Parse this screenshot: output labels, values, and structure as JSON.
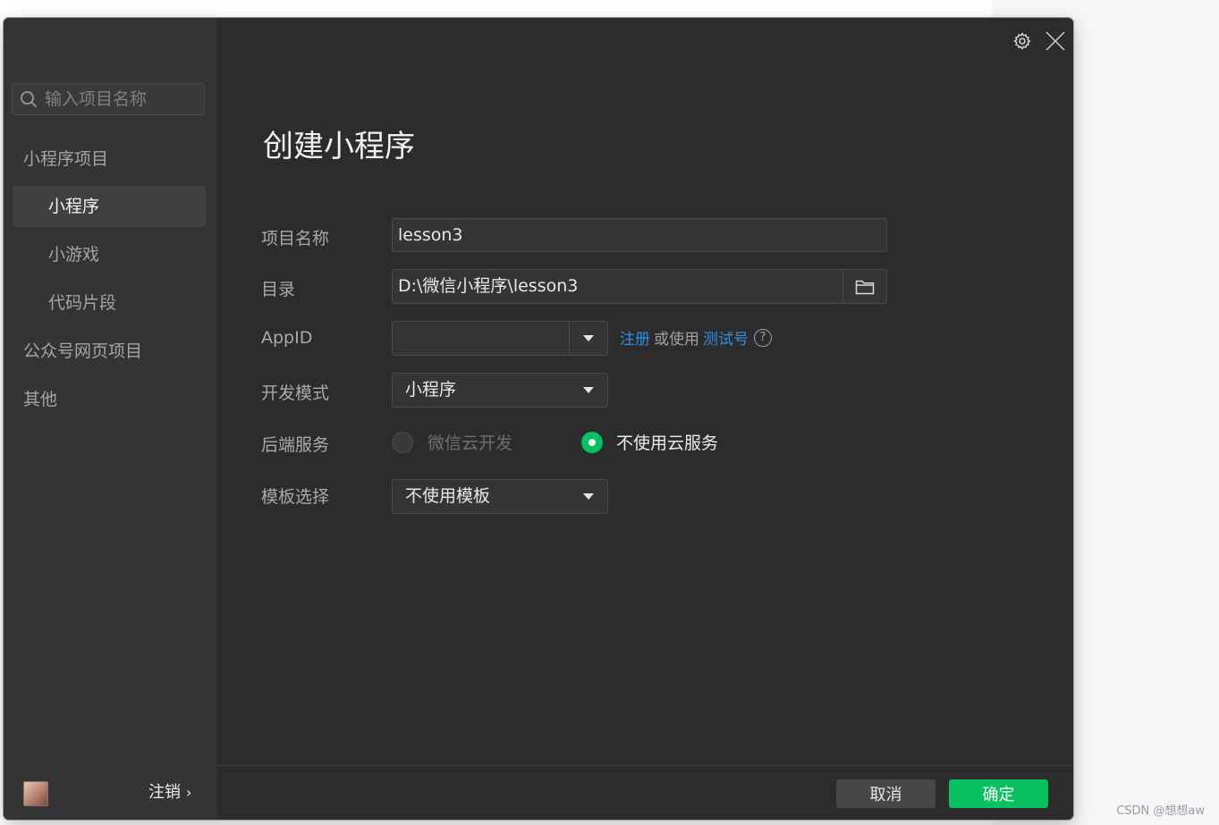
{
  "watermark": "CSDN @想想aw",
  "sidebar": {
    "search_placeholder": "输入项目名称",
    "group_miniprogram": "小程序项目",
    "items": [
      "小程序",
      "小游戏",
      "代码片段"
    ],
    "group_official": "公众号网页项目",
    "group_other": "其他",
    "logout": "注销"
  },
  "main": {
    "title": "创建小程序",
    "labels": {
      "project_name": "项目名称",
      "directory": "目录",
      "appid": "AppID",
      "dev_mode": "开发模式",
      "backend": "后端服务",
      "template": "模板选择"
    },
    "project_name_value": "lesson3",
    "directory_value": "D:\\微信小程序\\lesson3",
    "appid_value": "",
    "appid_register": "注册",
    "appid_or_use": "或使用",
    "appid_test": "测试号",
    "dev_mode_value": "小程序",
    "backend_options": [
      "微信云开发",
      "不使用云服务"
    ],
    "backend_selected": "不使用云服务",
    "template_value": "不使用模板"
  },
  "footer": {
    "cancel": "取消",
    "confirm": "确定"
  },
  "colors": {
    "accent_green": "#07c160",
    "link_blue": "#2f8fe8",
    "dialog_bg": "#2c2c2c",
    "sidebar_bg": "#343434"
  },
  "icons": [
    "search-icon",
    "settings-icon",
    "close-icon",
    "folder-icon",
    "dropdown-arrow-icon",
    "help-icon",
    "chevron-right-icon"
  ]
}
